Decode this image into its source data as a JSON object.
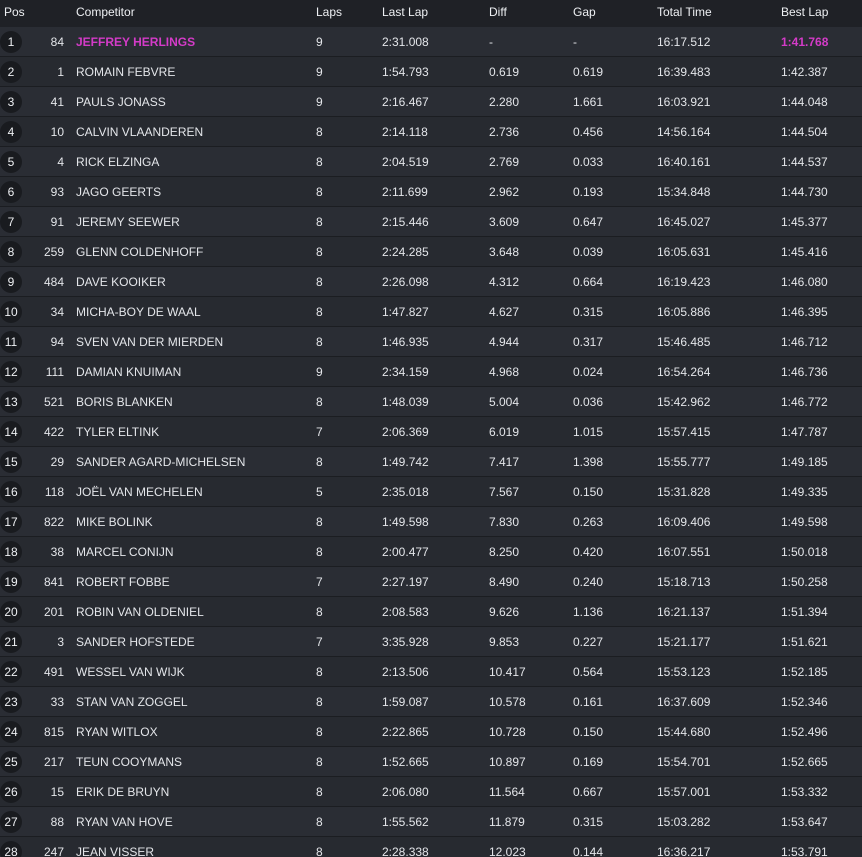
{
  "header": {
    "pos": "Pos",
    "competitor": "Competitor",
    "laps": "Laps",
    "last_lap": "Last Lap",
    "diff": "Diff",
    "gap": "Gap",
    "total_time": "Total Time",
    "best_lap": "Best Lap"
  },
  "colors": {
    "highlight": "#d43bc8",
    "background": "#24272d",
    "header_bg": "#1f2126"
  },
  "rows": [
    {
      "pos": "1",
      "num": "84",
      "name": "JEFFREY HERLINGS",
      "laps": "9",
      "last": "2:31.008",
      "diff": "-",
      "gap": "-",
      "total": "16:17.512",
      "best": "1:41.768"
    },
    {
      "pos": "2",
      "num": "1",
      "name": "ROMAIN FEBVRE",
      "laps": "9",
      "last": "1:54.793",
      "diff": "0.619",
      "gap": "0.619",
      "total": "16:39.483",
      "best": "1:42.387"
    },
    {
      "pos": "3",
      "num": "41",
      "name": "PAULS JONASS",
      "laps": "9",
      "last": "2:16.467",
      "diff": "2.280",
      "gap": "1.661",
      "total": "16:03.921",
      "best": "1:44.048"
    },
    {
      "pos": "4",
      "num": "10",
      "name": "CALVIN VLAANDEREN",
      "laps": "8",
      "last": "2:14.118",
      "diff": "2.736",
      "gap": "0.456",
      "total": "14:56.164",
      "best": "1:44.504"
    },
    {
      "pos": "5",
      "num": "4",
      "name": "RICK ELZINGA",
      "laps": "8",
      "last": "2:04.519",
      "diff": "2.769",
      "gap": "0.033",
      "total": "16:40.161",
      "best": "1:44.537"
    },
    {
      "pos": "6",
      "num": "93",
      "name": "JAGO GEERTS",
      "laps": "8",
      "last": "2:11.699",
      "diff": "2.962",
      "gap": "0.193",
      "total": "15:34.848",
      "best": "1:44.730"
    },
    {
      "pos": "7",
      "num": "91",
      "name": "JEREMY SEEWER",
      "laps": "8",
      "last": "2:15.446",
      "diff": "3.609",
      "gap": "0.647",
      "total": "16:45.027",
      "best": "1:45.377"
    },
    {
      "pos": "8",
      "num": "259",
      "name": "GLENN COLDENHOFF",
      "laps": "8",
      "last": "2:24.285",
      "diff": "3.648",
      "gap": "0.039",
      "total": "16:05.631",
      "best": "1:45.416"
    },
    {
      "pos": "9",
      "num": "484",
      "name": "DAVE KOOIKER",
      "laps": "8",
      "last": "2:26.098",
      "diff": "4.312",
      "gap": "0.664",
      "total": "16:19.423",
      "best": "1:46.080"
    },
    {
      "pos": "10",
      "num": "34",
      "name": "MICHA-BOY DE WAAL",
      "laps": "8",
      "last": "1:47.827",
      "diff": "4.627",
      "gap": "0.315",
      "total": "16:05.886",
      "best": "1:46.395"
    },
    {
      "pos": "11",
      "num": "94",
      "name": "SVEN VAN DER MIERDEN",
      "laps": "8",
      "last": "1:46.935",
      "diff": "4.944",
      "gap": "0.317",
      "total": "15:46.485",
      "best": "1:46.712"
    },
    {
      "pos": "12",
      "num": "111",
      "name": "DAMIAN KNUIMAN",
      "laps": "9",
      "last": "2:34.159",
      "diff": "4.968",
      "gap": "0.024",
      "total": "16:54.264",
      "best": "1:46.736"
    },
    {
      "pos": "13",
      "num": "521",
      "name": "BORIS BLANKEN",
      "laps": "8",
      "last": "1:48.039",
      "diff": "5.004",
      "gap": "0.036",
      "total": "15:42.962",
      "best": "1:46.772"
    },
    {
      "pos": "14",
      "num": "422",
      "name": "TYLER ELTINK",
      "laps": "7",
      "last": "2:06.369",
      "diff": "6.019",
      "gap": "1.015",
      "total": "15:57.415",
      "best": "1:47.787"
    },
    {
      "pos": "15",
      "num": "29",
      "name": "SANDER AGARD-MICHELSEN",
      "laps": "8",
      "last": "1:49.742",
      "diff": "7.417",
      "gap": "1.398",
      "total": "15:55.777",
      "best": "1:49.185"
    },
    {
      "pos": "16",
      "num": "118",
      "name": "JOËL VAN MECHELEN",
      "laps": "5",
      "last": "2:35.018",
      "diff": "7.567",
      "gap": "0.150",
      "total": "15:31.828",
      "best": "1:49.335"
    },
    {
      "pos": "17",
      "num": "822",
      "name": "MIKE BOLINK",
      "laps": "8",
      "last": "1:49.598",
      "diff": "7.830",
      "gap": "0.263",
      "total": "16:09.406",
      "best": "1:49.598"
    },
    {
      "pos": "18",
      "num": "38",
      "name": "MARCEL CONIJN",
      "laps": "8",
      "last": "2:00.477",
      "diff": "8.250",
      "gap": "0.420",
      "total": "16:07.551",
      "best": "1:50.018"
    },
    {
      "pos": "19",
      "num": "841",
      "name": "ROBERT FOBBE",
      "laps": "7",
      "last": "2:27.197",
      "diff": "8.490",
      "gap": "0.240",
      "total": "15:18.713",
      "best": "1:50.258"
    },
    {
      "pos": "20",
      "num": "201",
      "name": "ROBIN VAN OLDENIEL",
      "laps": "8",
      "last": "2:08.583",
      "diff": "9.626",
      "gap": "1.136",
      "total": "16:21.137",
      "best": "1:51.394"
    },
    {
      "pos": "21",
      "num": "3",
      "name": "SANDER HOFSTEDE",
      "laps": "7",
      "last": "3:35.928",
      "diff": "9.853",
      "gap": "0.227",
      "total": "15:21.177",
      "best": "1:51.621"
    },
    {
      "pos": "22",
      "num": "491",
      "name": "WESSEL VAN WIJK",
      "laps": "8",
      "last": "2:13.506",
      "diff": "10.417",
      "gap": "0.564",
      "total": "15:53.123",
      "best": "1:52.185"
    },
    {
      "pos": "23",
      "num": "33",
      "name": "STAN VAN ZOGGEL",
      "laps": "8",
      "last": "1:59.087",
      "diff": "10.578",
      "gap": "0.161",
      "total": "16:37.609",
      "best": "1:52.346"
    },
    {
      "pos": "24",
      "num": "815",
      "name": "RYAN WITLOX",
      "laps": "8",
      "last": "2:22.865",
      "diff": "10.728",
      "gap": "0.150",
      "total": "15:44.680",
      "best": "1:52.496"
    },
    {
      "pos": "25",
      "num": "217",
      "name": "TEUN COOYMANS",
      "laps": "8",
      "last": "1:52.665",
      "diff": "10.897",
      "gap": "0.169",
      "total": "15:54.701",
      "best": "1:52.665"
    },
    {
      "pos": "26",
      "num": "15",
      "name": "ERIK DE BRUYN",
      "laps": "8",
      "last": "2:06.080",
      "diff": "11.564",
      "gap": "0.667",
      "total": "15:57.001",
      "best": "1:53.332"
    },
    {
      "pos": "27",
      "num": "88",
      "name": "RYAN VAN HOVE",
      "laps": "8",
      "last": "1:55.562",
      "diff": "11.879",
      "gap": "0.315",
      "total": "15:03.282",
      "best": "1:53.647"
    },
    {
      "pos": "28",
      "num": "247",
      "name": "JEAN VISSER",
      "laps": "8",
      "last": "2:28.338",
      "diff": "12.023",
      "gap": "0.144",
      "total": "16:36.217",
      "best": "1:53.791"
    }
  ]
}
